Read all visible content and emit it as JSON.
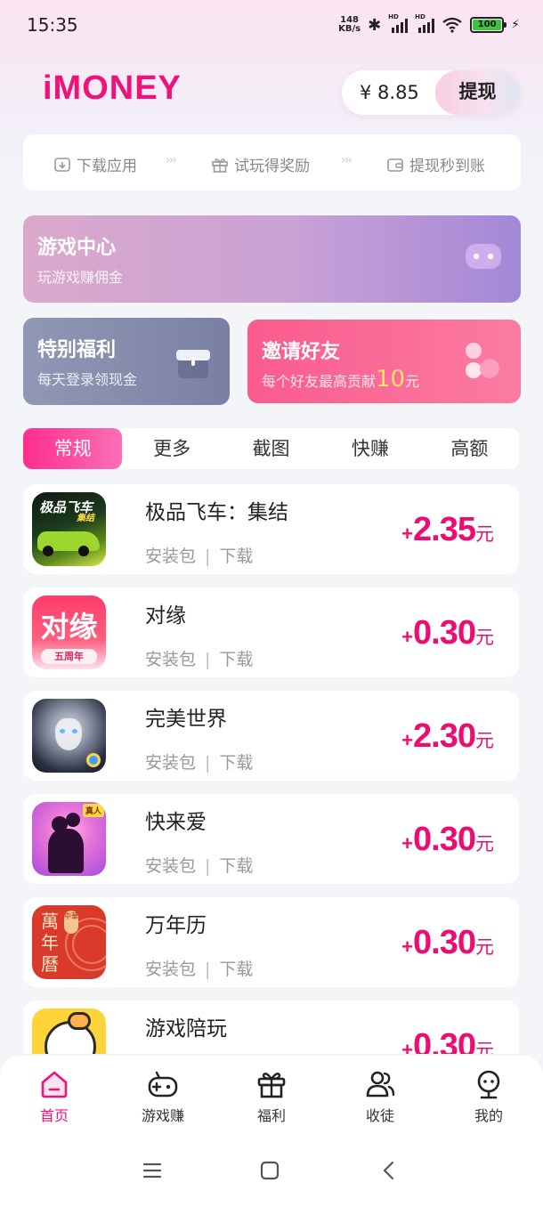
{
  "status_bar": {
    "time": "15:35",
    "net_speed_value": "148",
    "net_speed_unit": "KB/s",
    "signal_label": "HD",
    "battery": "100"
  },
  "header": {
    "logo": "iMONEY",
    "balance": "¥ 8.85",
    "withdraw_label": "提现"
  },
  "steps": [
    {
      "label": "下载应用",
      "icon": "download-box-icon"
    },
    {
      "label": "试玩得奖励",
      "icon": "gift-icon"
    },
    {
      "label": "提现秒到账",
      "icon": "wallet-icon"
    }
  ],
  "step_arrows": "›››",
  "banners": {
    "game_center": {
      "title": "游戏中心",
      "subtitle": "玩游戏赚佣金",
      "icon": "gamepad-icon"
    },
    "welfare": {
      "title": "特别福利",
      "subtitle": "每天登录领现金",
      "icon": "gift-box-icon"
    },
    "invite": {
      "title": "邀请好友",
      "subtitle_prefix": "每个好友最高贡献",
      "subtitle_amount": "10",
      "subtitle_unit": "元",
      "icon": "friends-icon"
    }
  },
  "tabs": [
    "常规",
    "更多",
    "截图",
    "快赚",
    "高额"
  ],
  "active_tab": 0,
  "apps": [
    {
      "name": "极品飞车：集结",
      "type": "安装包",
      "action": "下载",
      "reward": "2.35",
      "icon": "need-for-speed-icon"
    },
    {
      "name": "对缘",
      "type": "安装包",
      "action": "下载",
      "reward": "0.30",
      "icon": "duiyuan-icon"
    },
    {
      "name": "完美世界",
      "type": "安装包",
      "action": "下载",
      "reward": "2.30",
      "icon": "perfect-world-icon"
    },
    {
      "name": "快来爱",
      "type": "安装包",
      "action": "下载",
      "reward": "0.30",
      "icon": "kuailaiai-icon"
    },
    {
      "name": "万年历",
      "type": "安装包",
      "action": "下载",
      "reward": "0.30",
      "icon": "calendar-app-icon"
    },
    {
      "name": "游戏陪玩",
      "type": "安装包",
      "action": "下载",
      "reward": "0.30",
      "icon": "game-companion-icon"
    }
  ],
  "reward_plus": "+",
  "reward_unit": "元",
  "meta_separator": "|",
  "app_icon_text": {
    "nfs_title": "极品飞车",
    "nfs_sub": "集结",
    "duiyuan_title": "对缘",
    "duiyuan_badge": "五周年",
    "calendar_chars": "萬年曆",
    "calendar_badge": "中華",
    "kla_badge": "真人"
  },
  "bottom_nav": [
    {
      "label": "首页",
      "icon": "home-icon"
    },
    {
      "label": "游戏赚",
      "icon": "gamepad-icon"
    },
    {
      "label": "福利",
      "icon": "gift-icon"
    },
    {
      "label": "收徒",
      "icon": "users-icon"
    },
    {
      "label": "我的",
      "icon": "profile-icon"
    }
  ],
  "active_nav": 0,
  "colors": {
    "accent": "#f0127b",
    "tab_active": "#ff2d8d"
  }
}
